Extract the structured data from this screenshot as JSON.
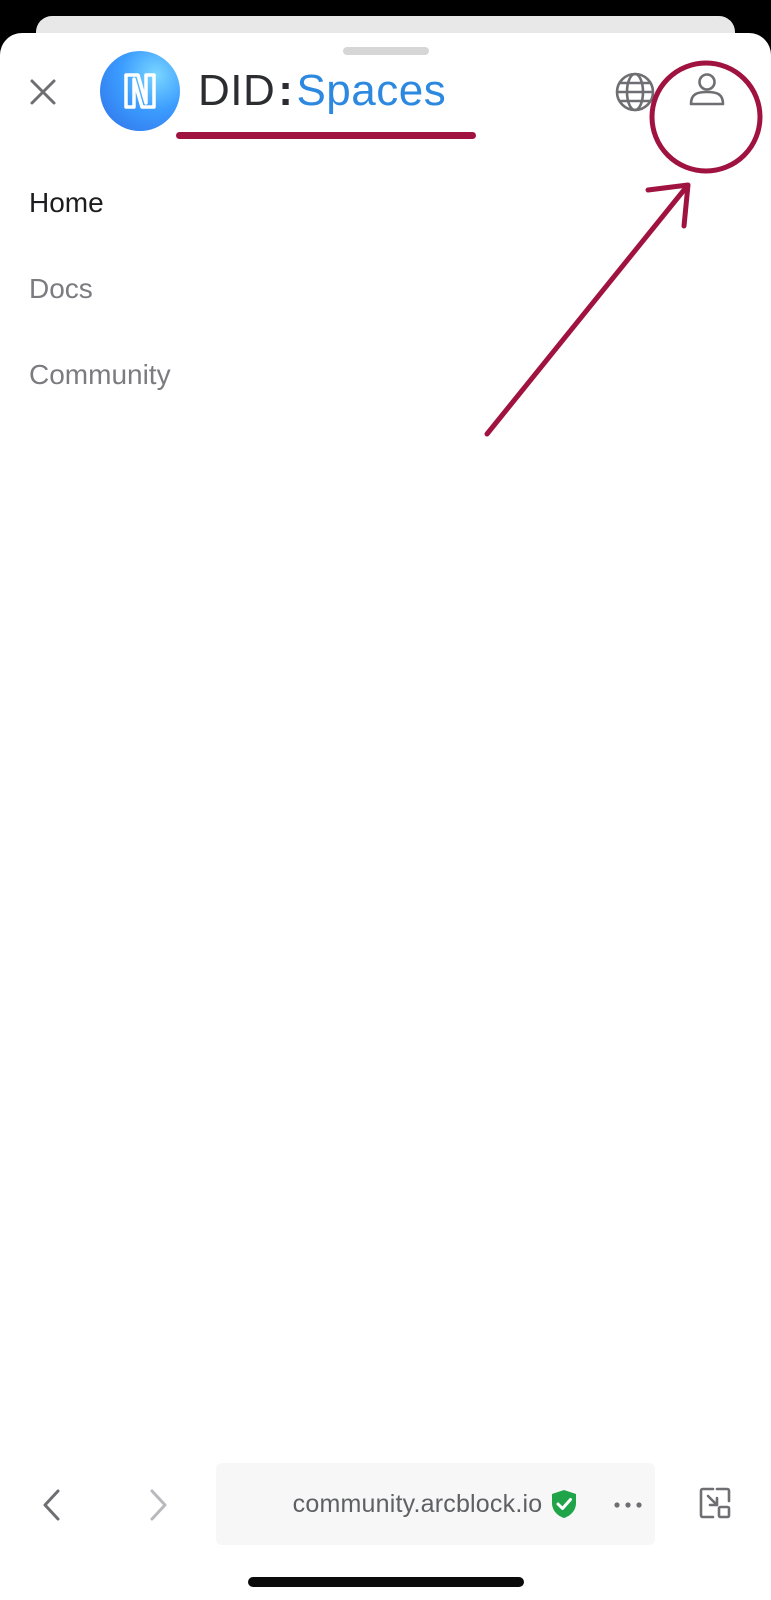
{
  "header": {
    "logo": {
      "did": "DID",
      "colon": ":",
      "spaces": "Spaces"
    }
  },
  "nav": {
    "items": [
      {
        "label": "Home",
        "active": true
      },
      {
        "label": "Docs",
        "active": false
      },
      {
        "label": "Community",
        "active": false
      }
    ]
  },
  "browser_bar": {
    "url": "community.arcblock.io",
    "secure": true
  },
  "colors": {
    "annotation": "#a0123f",
    "logo_blue": "#2d88e0",
    "secure_green": "#1fa449",
    "text_active": "#1d1d1f",
    "text_inactive": "#7b7b80"
  },
  "icons": {
    "close": "close-icon",
    "globe": "globe-icon",
    "user": "user-icon",
    "back": "chevron-left-icon",
    "forward": "chevron-right-icon",
    "shield": "shield-check-icon",
    "more": "more-horizontal-icon",
    "pip": "picture-in-picture-icon"
  }
}
